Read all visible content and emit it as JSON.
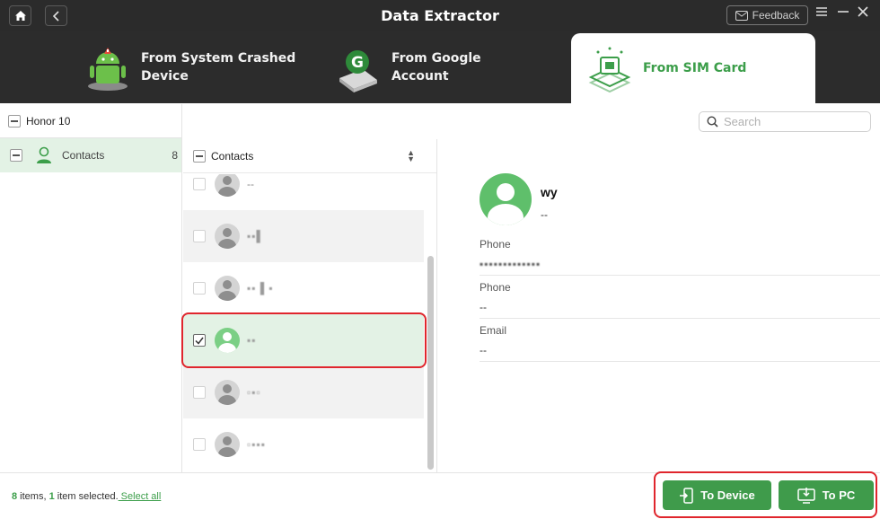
{
  "window": {
    "title": "Data Extractor",
    "feedback_label": "Feedback"
  },
  "tabs": [
    {
      "label": "From System Crashed Device",
      "line1": "From System Crashed",
      "line2": "Device",
      "active": false
    },
    {
      "label": "From Google Account",
      "active": false
    },
    {
      "label": "From SIM Card",
      "active": true
    }
  ],
  "colors": {
    "accent": "#3c9e4a",
    "highlight": "#e0262d",
    "titlebar": "#2b2b2b"
  },
  "device": {
    "name": "Honor 10"
  },
  "categories": [
    {
      "label": "Contacts",
      "count": "8",
      "icon": "person-icon"
    }
  ],
  "search": {
    "placeholder": "Search"
  },
  "contact_list": {
    "header": "Contacts",
    "rows": [
      {
        "name": "--",
        "checked": false
      },
      {
        "name": "▪︎▪︎▌",
        "checked": false
      },
      {
        "name": "▪︎▪︎ ▌▪︎",
        "checked": false
      },
      {
        "name": "▪︎▪︎",
        "checked": true
      },
      {
        "name": "▫︎▪︎▫︎",
        "checked": false
      },
      {
        "name": "▫︎▪︎▪︎▪︎",
        "checked": false
      }
    ]
  },
  "detail": {
    "name": "wy",
    "subtitle": "--",
    "fields": [
      {
        "label": "Phone",
        "value": "▪︎▪︎▪︎▪︎▪︎▪︎▪︎▪︎▪︎▪︎▪︎▪︎▪︎"
      },
      {
        "label": "Phone",
        "value": "--"
      },
      {
        "label": "Email",
        "value": "--"
      }
    ]
  },
  "footer": {
    "items_count": "8",
    "items_text": " items, ",
    "selected_count": "1",
    "selected_text": " item selected.",
    "select_all": " Select all",
    "to_device": "To Device",
    "to_pc": "To PC"
  }
}
